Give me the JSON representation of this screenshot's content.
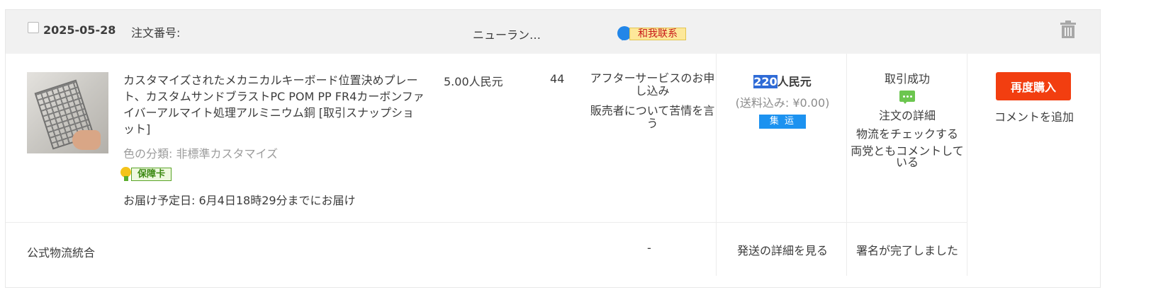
{
  "order": {
    "date": "2025-05-28",
    "order_number_label": "注文番号:",
    "shop_name": "ニューラン…",
    "contact_label": "和我联系",
    "icons": {
      "trash": "trash-icon",
      "chat": "chat-bubble-icon",
      "message": "message-icon",
      "guarantee": "guarantee-card-icon"
    }
  },
  "product": {
    "title": "カスタマイズされたメカニカルキーボード位置決めプレート、カスタムサンドブラストPC POM PP FR4カーボンファイバーアルマイト処理アルミニウム銅 [取引スナップショット]",
    "color": "色の分類: 非標準カスタマイズ",
    "guarantee_label": "保障卡",
    "delivery": "お届け予定日: 6月4日18時29分までにお届け",
    "unit_price": "5.00人民元",
    "quantity": "44"
  },
  "service": {
    "after_sales": "アフターサービスのお申し込み",
    "complaint": "販売者について苦情を言う"
  },
  "total": {
    "amount": "220",
    "currency": "人民元",
    "shipping": "(送料込み: ¥0.00)",
    "badge": "集 运"
  },
  "status": {
    "state": "取引成功",
    "details": "注文の詳細",
    "logistics": "物流をチェックする",
    "both_comment": "両党ともコメントしている"
  },
  "actions": {
    "rebuy": "再度購入",
    "add_comment": "コメントを追加"
  },
  "footer": {
    "logistics_label": "公式物流統合",
    "dash": "-",
    "shipping_details": "発送の詳細を見る",
    "signed": "署名が完了しました"
  },
  "colors": {
    "header_bg": "#f1f1f1",
    "rebuy_bg": "#f23e10",
    "badge_bg": "#1c92f0",
    "highlight": "#2f6bd6"
  }
}
